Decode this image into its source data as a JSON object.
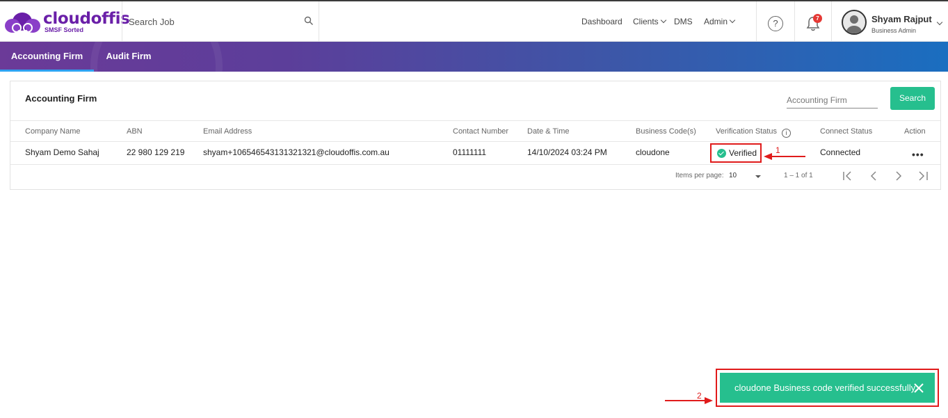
{
  "header": {
    "logo_name": "cloudoffis",
    "logo_tagline": "SMSF Sorted",
    "search_placeholder": "Search Job",
    "nav": [
      {
        "label": "Dashboard"
      },
      {
        "label": "Clients"
      },
      {
        "label": "DMS"
      },
      {
        "label": "Admin"
      }
    ],
    "notification_count": "7",
    "user_name": "Shyam Rajput",
    "user_role": "Business Admin"
  },
  "tabs": [
    {
      "label": "Accounting Firm",
      "active": true
    },
    {
      "label": "Audit Firm",
      "active": false
    }
  ],
  "card": {
    "title": "Accounting Firm",
    "filter_placeholder": "Accounting Firm",
    "search_button": "Search"
  },
  "table": {
    "headers": [
      "Company Name",
      "ABN",
      "Email Address",
      "Contact Number",
      "Date & Time",
      "Business Code(s)",
      "Verification Status",
      "Connect Status",
      "Action"
    ],
    "rows": [
      {
        "company": "Shyam Demo Sahaj",
        "abn": "22 980 129 219",
        "email": "shyam+106546543131321321@cloudoffis.com.au",
        "contact": "01111111",
        "datetime": "14/10/2024 03:24 PM",
        "business_code": "cloudone",
        "verification": "Verified",
        "connect": "Connected",
        "action": "•••"
      }
    ]
  },
  "pagination": {
    "items_label": "Items per page:",
    "items_value": "10",
    "range": "1 – 1 of 1"
  },
  "annotations": {
    "marker_1": "1",
    "marker_2": "2"
  },
  "toast": {
    "message": "cloudone Business code verified successfully."
  },
  "colors": {
    "brand": "#6a1fa8",
    "accent_green": "#26bf8e",
    "annotation_red": "#e01b1b"
  }
}
